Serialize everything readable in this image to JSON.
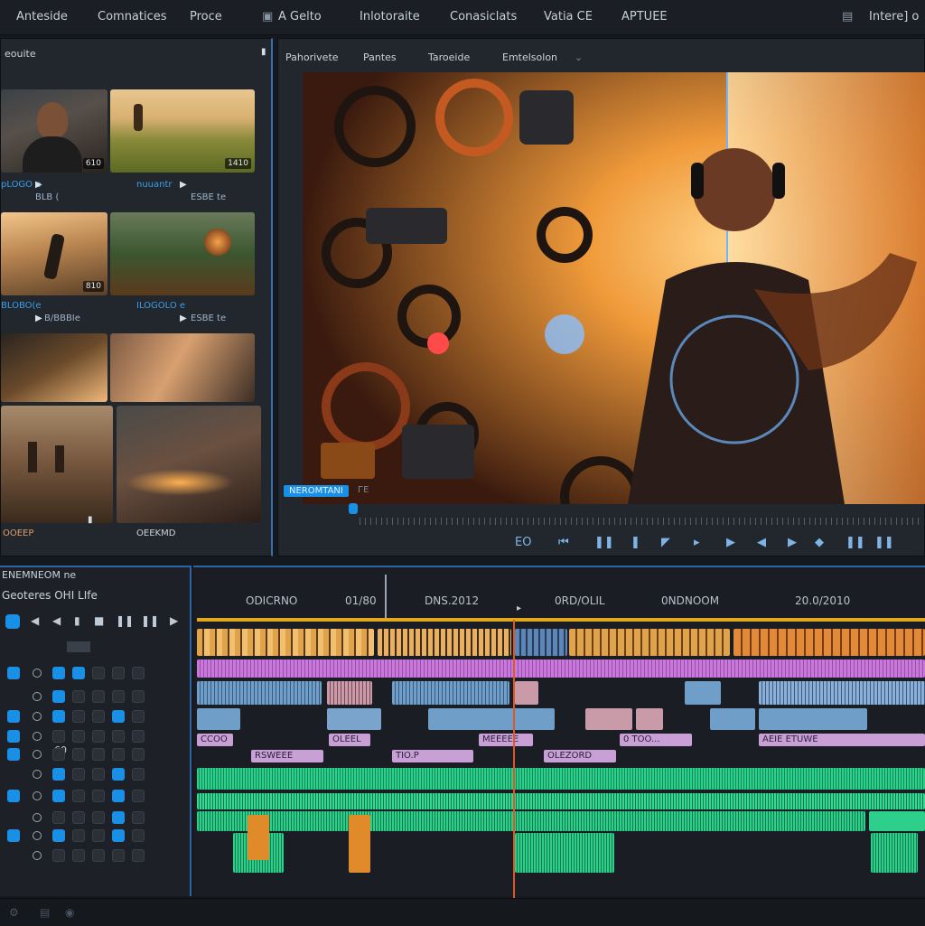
{
  "menu": [
    "Anteside",
    "Comnatices",
    "Proce",
    "A Gelto",
    "Inlotoraite",
    "Conasiclats",
    "Vatia CE",
    "APTUEE"
  ],
  "menu_right": "Intere] o",
  "media_panel": {
    "title": "eouite",
    "thumbs": [
      {
        "row": 0,
        "badge": "610",
        "cap1": "pLOGO e",
        "cap2": "BLB ("
      },
      {
        "row": 0,
        "badge": "1410",
        "cap1": "nuuantr",
        "cap2": "ESBE te"
      },
      {
        "row": 1,
        "badge": "810",
        "cap1": "BLOBO(e",
        "cap2": "B/BBBIe"
      },
      {
        "row": 1,
        "badge": "",
        "cap1": "ILOGOLO e",
        "cap2": "ESBE te"
      }
    ],
    "bottom_left_label": "OOEEP",
    "bottom_right_label": "OEEKMD"
  },
  "viewer": {
    "tabs": [
      "Pahorivete",
      "Pantes",
      "Taroeide",
      "Emtelsolon"
    ],
    "timecode_chip": "NEROMTANI",
    "marker": "ГЕ",
    "controls": [
      "EO",
      "⏮",
      "❚❚",
      "❚",
      "◤",
      "▸",
      "▶",
      "◀",
      "▶",
      "◆",
      "❚❚",
      "❚❚"
    ]
  },
  "track_header": {
    "title": "ENEMNEOM ne",
    "subtitle": "Geoteres OHI LIfe",
    "number_label": "60"
  },
  "timeline": {
    "time_labels": [
      "ODICRNO",
      "01/80",
      "DNS.2012",
      "0RD/OLIL",
      "0NDNOOM",
      "20.0/2010"
    ],
    "clip_labels": [
      "CCOO",
      "RSWEEE",
      "OLEEL",
      "TIO.P",
      "MEEEEE",
      "OLEZORD",
      "0 TOO...",
      "AEIE  ETUWE"
    ]
  },
  "colors": {
    "accent": "#1a8fe6",
    "video": "#e0a24a",
    "pink": "#c77ad8",
    "blue_clip": "#6f9ec9",
    "green": "#2ecf8a",
    "playhead": "#d85a2a"
  }
}
